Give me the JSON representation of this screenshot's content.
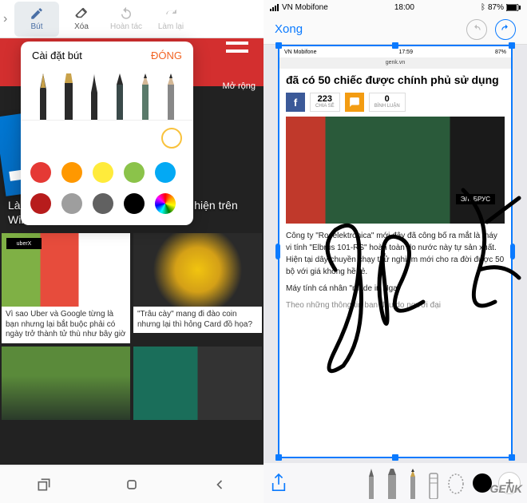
{
  "left": {
    "toolbar": {
      "pen": "Bút",
      "erase": "Xóa",
      "undo": "Hoàn tác",
      "redo": "Làm lại"
    },
    "popup": {
      "title": "Cài đặt bút",
      "close": "ĐÓNG",
      "colors": [
        "#e53935",
        "#ff9800",
        "#ffeb3b",
        "#8bc34a",
        "#4caf50",
        "#03a9f4",
        "#b71c1c",
        "#9e9e9e",
        "#616161",
        "#000000"
      ],
      "rainbow": true
    },
    "redbar": {
      "expand": "Mở rộng"
    },
    "article_overlay": "Làn ... Office bản hoàn chính da xuất hiện trên Windows Store",
    "news": [
      {
        "img_label": "uberX",
        "title": "Vì sao Uber và Google từng là bạn nhưng lại bắt buộc phải có ngày trở thành tử thù như bây giờ"
      },
      {
        "title": "\"Trâu cày\" mang đi đào coin nhưng lại thì hỏng Card đồ họa?"
      },
      {
        "title": ""
      },
      {
        "title": ""
      }
    ]
  },
  "right": {
    "status": {
      "carrier": "VN Mobifone",
      "time": "18:00",
      "battery": "87%"
    },
    "header": {
      "done": "Xong"
    },
    "mini_status": {
      "carrier": "VN Mobifone",
      "time": "17:59",
      "battery": "87%"
    },
    "mini_url": "genk.vn",
    "article": {
      "title": "đã có 50 chiếc được chính phủ sử dụng",
      "shares_n": "223",
      "shares_l": "CHIA SẺ",
      "comments_n": "0",
      "comments_l": "BÌNH LUẬN",
      "photo_label": "ЭЛЬБРУС",
      "p1": "Công ty \"Roselektronica\" mới đây đã công bố ra mắt là máy vi tính \"Elbrus 101-RS\" hoàn toàn do nước này tự sản xuất. Hiện tại dây chuyền chạy thử nghiệm mới cho ra đời được 50 bộ với giá không hề rẻ.",
      "p2": "Máy tính cá nhân \"made in Nga\"",
      "p3": "Theo những thông tin ban đầu do người đại"
    },
    "watermark": "GENK"
  }
}
